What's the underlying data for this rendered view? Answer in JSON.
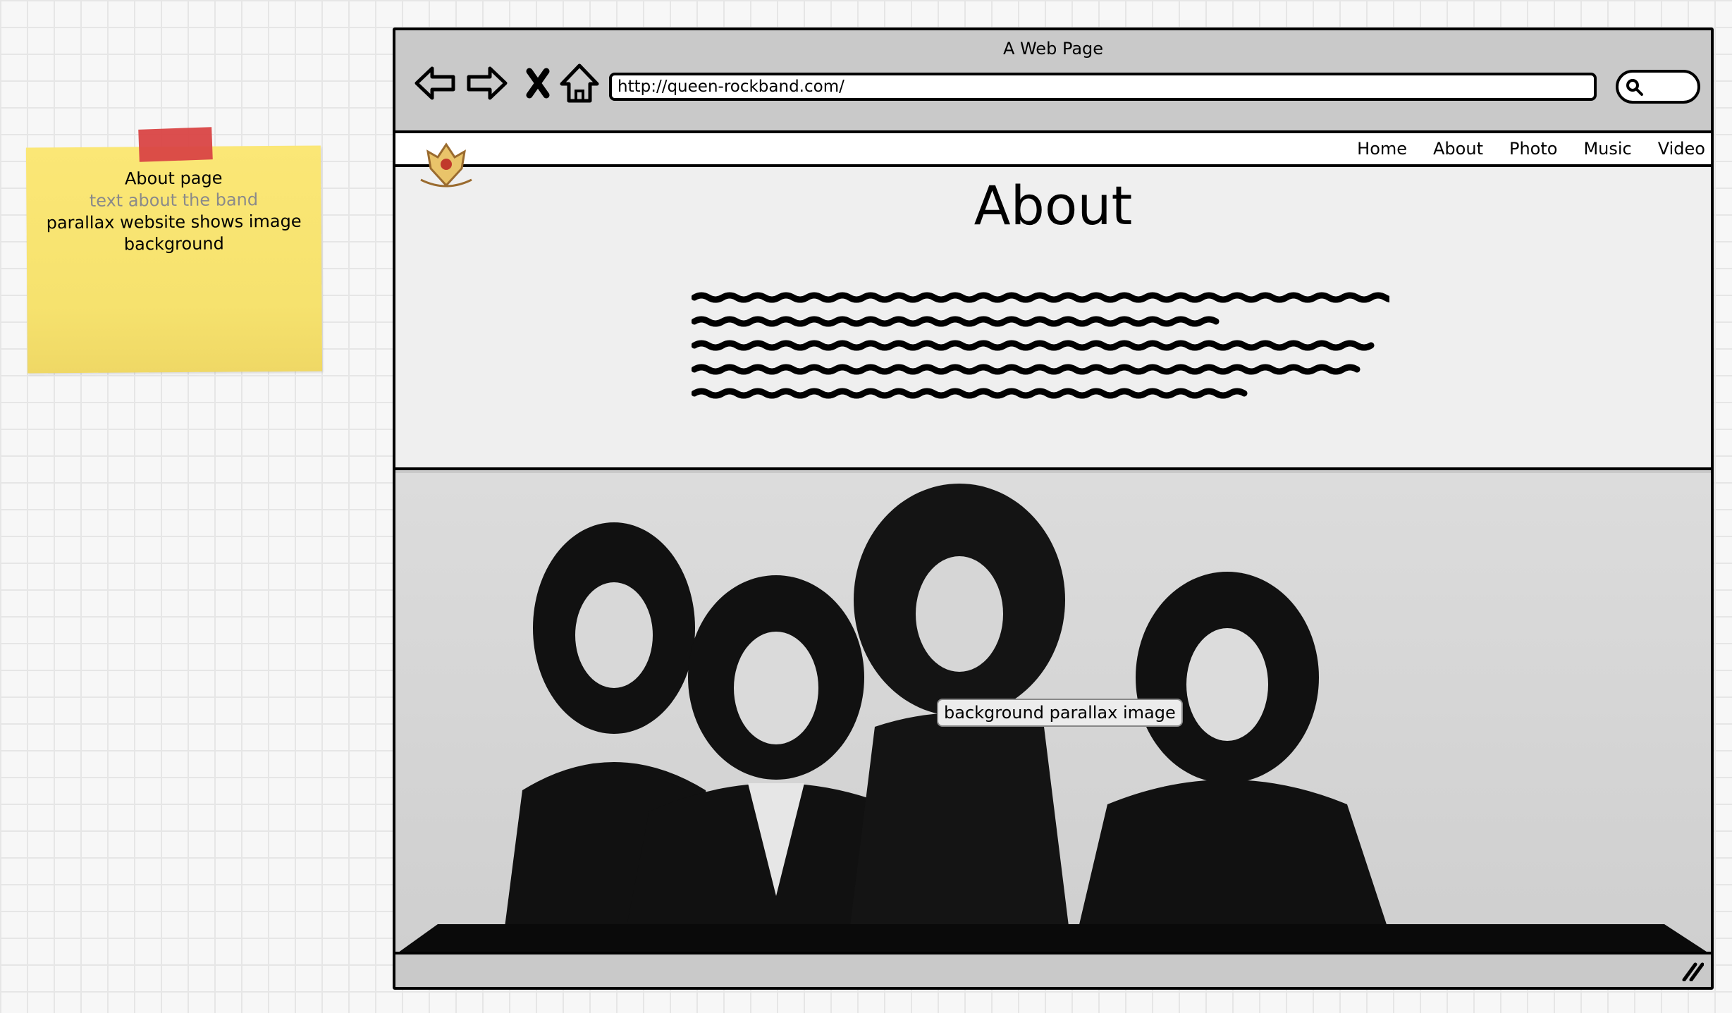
{
  "sticky": {
    "line1": "About page",
    "line2": "text about the band",
    "line3": "parallax website shows image",
    "line4": "background",
    "muted_color": "#8a8a8a"
  },
  "window": {
    "title": "A Web Page",
    "url": "http://queen-rockband.com/",
    "buttons": [
      "back-arrow-icon",
      "forward-arrow-icon",
      "close-icon",
      "home-icon"
    ],
    "search_icon": "search-icon"
  },
  "nav": {
    "items": [
      "Home",
      "About",
      "Photo",
      "Music",
      "Video"
    ]
  },
  "about": {
    "title": "About"
  },
  "photo": {
    "callout": "background parallax image"
  }
}
